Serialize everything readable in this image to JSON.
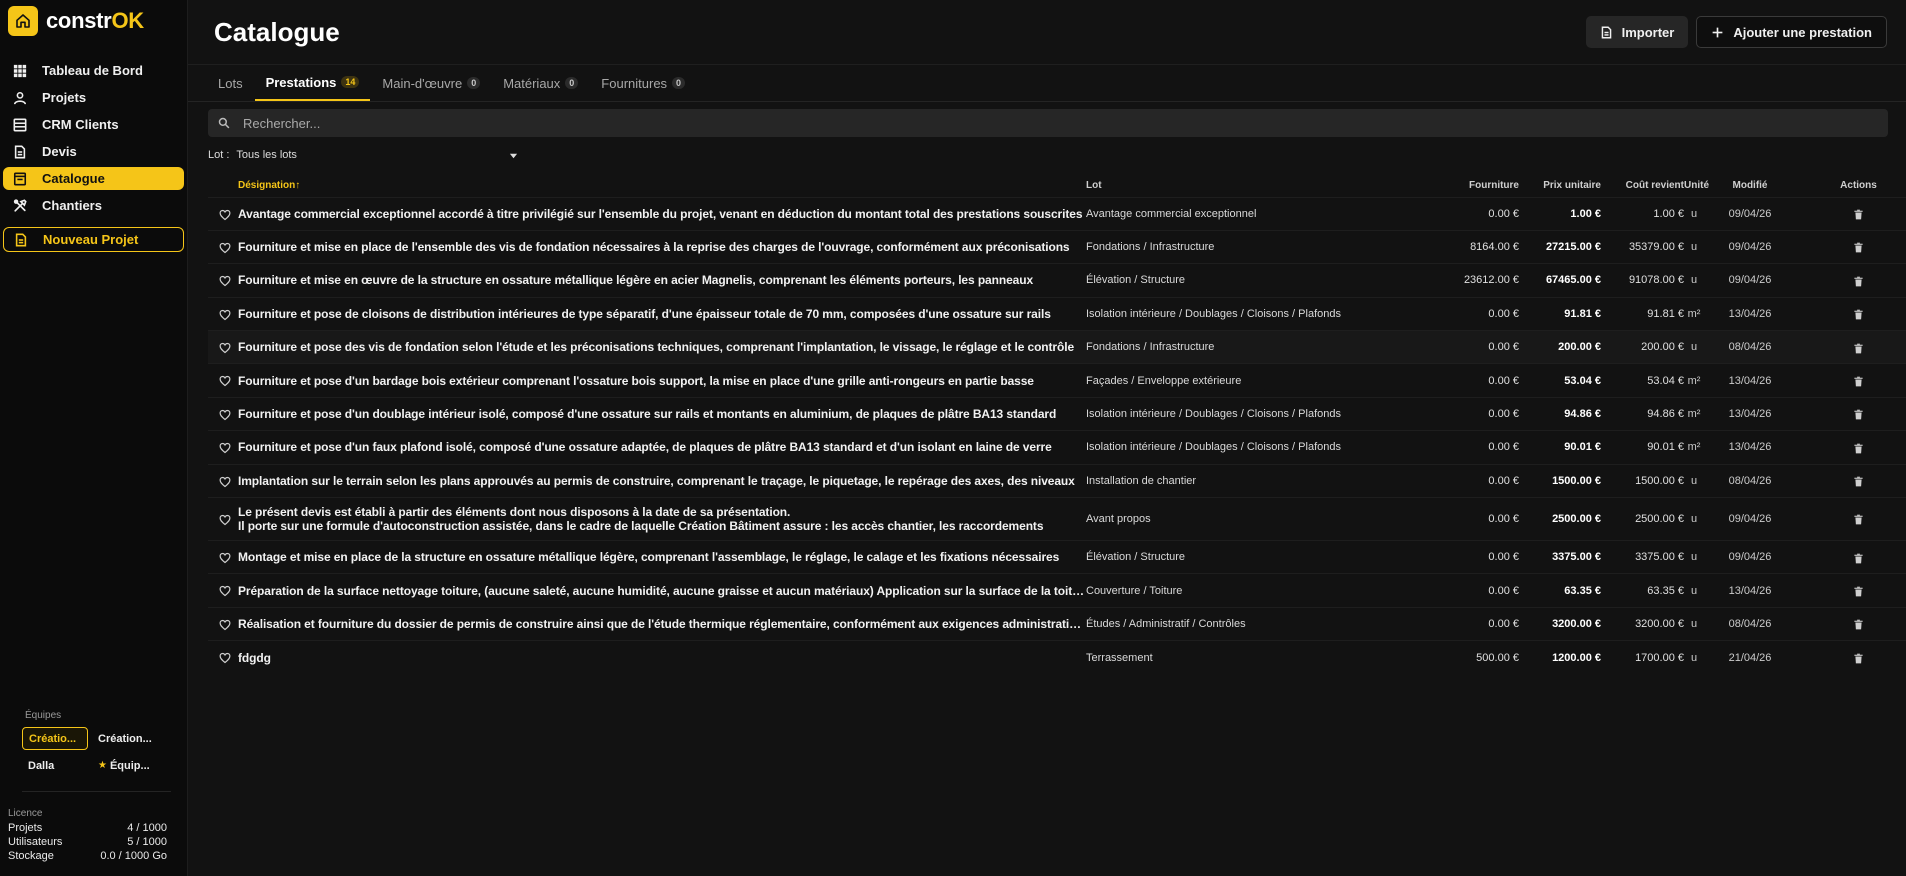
{
  "brand": {
    "name_main": "constr",
    "name_accent": "OK"
  },
  "sidebar": {
    "items": [
      {
        "label": "Tableau de Bord",
        "icon": "grid-icon"
      },
      {
        "label": "Projets",
        "icon": "user-icon"
      },
      {
        "label": "CRM Clients",
        "icon": "database-icon"
      },
      {
        "label": "Devis",
        "icon": "document-icon"
      },
      {
        "label": "Catalogue",
        "icon": "catalog-icon",
        "active": true
      },
      {
        "label": "Chantiers",
        "icon": "tools-icon"
      }
    ],
    "new_project": "Nouveau Projet"
  },
  "teams": {
    "title": "Équipes",
    "items": [
      "Créatio...",
      "Création...",
      "Dalla",
      "Équip..."
    ]
  },
  "license": {
    "title": "Licence",
    "rows": [
      {
        "label": "Projets",
        "value": "4 / 1000"
      },
      {
        "label": "Utilisateurs",
        "value": "5 / 1000"
      },
      {
        "label": "Stockage",
        "value": "0.0 / 1000 Go"
      }
    ]
  },
  "header": {
    "title": "Catalogue",
    "import_label": "Importer",
    "add_label": "Ajouter une prestation"
  },
  "tabs": [
    {
      "label": "Lots",
      "count": ""
    },
    {
      "label": "Prestations",
      "count": "14",
      "active": true
    },
    {
      "label": "Main-d'œuvre",
      "count": "0"
    },
    {
      "label": "Matériaux",
      "count": "0"
    },
    {
      "label": "Fournitures",
      "count": "0"
    }
  ],
  "search": {
    "placeholder": "Rechercher..."
  },
  "filter": {
    "label": "Lot :",
    "value": "Tous les lots"
  },
  "table": {
    "headers": {
      "designation": "Désignation",
      "sort_arrow": "↑",
      "lot": "Lot",
      "fourniture": "Fourniture",
      "prix": "Prix unitaire",
      "cout": "Coût revient",
      "unite": "Unité",
      "modifie": "Modifié",
      "actions": "Actions"
    },
    "rows": [
      {
        "des": "Avantage commercial exceptionnel accordé à titre privilégié sur l'ensemble du projet, venant en déduction du montant total des prestations souscrites",
        "lot": "Avantage commercial exceptionnel",
        "fourniture": "0.00 €",
        "prix": "1.00 €",
        "cout": "1.00 €",
        "unite": "u",
        "modifie": "09/04/26"
      },
      {
        "des": "Fourniture et mise en place de l'ensemble des vis de fondation nécessaires à la reprise des charges de l'ouvrage, conformément aux préconisations",
        "lot": "Fondations / Infrastructure",
        "fourniture": "8164.00 €",
        "prix": "27215.00 €",
        "cout": "35379.00 €",
        "unite": "u",
        "modifie": "09/04/26"
      },
      {
        "des": "Fourniture et mise en œuvre de la structure en ossature métallique légère en acier Magnelis, comprenant les éléments porteurs, les panneaux",
        "lot": "Élévation / Structure",
        "fourniture": "23612.00 €",
        "prix": "67465.00 €",
        "cout": "91078.00 €",
        "unite": "u",
        "modifie": "09/04/26"
      },
      {
        "des": "Fourniture et pose de cloisons de distribution intérieures de type séparatif, d'une épaisseur totale de 70 mm, composées d'une ossature sur rails",
        "lot": "Isolation intérieure / Doublages / Cloisons / Plafonds",
        "fourniture": "0.00 €",
        "prix": "91.81 €",
        "cout": "91.81 €",
        "unite": "m²",
        "modifie": "13/04/26"
      },
      {
        "des": "Fourniture et pose des vis de fondation selon l'étude et les préconisations techniques, comprenant l'implantation, le vissage, le réglage et le contrôle",
        "lot": "Fondations / Infrastructure",
        "fourniture": "0.00 €",
        "prix": "200.00 €",
        "cout": "200.00 €",
        "unite": "u",
        "modifie": "08/04/26",
        "hl": true
      },
      {
        "des": "Fourniture et pose d'un bardage bois extérieur comprenant l'ossature bois support, la mise en place d'une grille anti-rongeurs en partie basse",
        "lot": "Façades / Enveloppe extérieure",
        "fourniture": "0.00 €",
        "prix": "53.04 €",
        "cout": "53.04 €",
        "unite": "m²",
        "modifie": "13/04/26"
      },
      {
        "des": "Fourniture et pose d'un doublage intérieur isolé, composé d'une ossature sur rails et montants en aluminium, de plaques de plâtre BA13 standard",
        "lot": "Isolation intérieure / Doublages / Cloisons / Plafonds",
        "fourniture": "0.00 €",
        "prix": "94.86 €",
        "cout": "94.86 €",
        "unite": "m²",
        "modifie": "13/04/26"
      },
      {
        "des": "Fourniture et pose d'un faux plafond isolé, composé d'une ossature adaptée, de plaques de plâtre BA13 standard et d'un isolant en laine de verre",
        "lot": "Isolation intérieure / Doublages / Cloisons / Plafonds",
        "fourniture": "0.00 €",
        "prix": "90.01 €",
        "cout": "90.01 €",
        "unite": "m²",
        "modifie": "13/04/26"
      },
      {
        "des": "Implantation sur le terrain selon les plans approuvés au permis de construire, comprenant le traçage, le piquetage, le repérage des axes, des niveaux",
        "lot": "Installation de chantier",
        "fourniture": "0.00 €",
        "prix": "1500.00 €",
        "cout": "1500.00 €",
        "unite": "u",
        "modifie": "08/04/26"
      },
      {
        "des": "Le présent devis est établi à partir des éléments dont nous disposons à la date de sa présentation.",
        "des2": "Il porte sur une formule d'autoconstruction assistée, dans le cadre de laquelle Création Bâtiment assure : les accès chantier, les raccordements",
        "lot": "Avant propos",
        "fourniture": "0.00 €",
        "prix": "2500.00 €",
        "cout": "2500.00 €",
        "unite": "u",
        "modifie": "09/04/26",
        "tall": true
      },
      {
        "des": "Montage et mise en place de la structure en ossature métallique légère, comprenant l'assemblage, le réglage, le calage et les fixations nécessaires",
        "lot": "Élévation / Structure",
        "fourniture": "0.00 €",
        "prix": "3375.00 €",
        "cout": "3375.00 €",
        "unite": "u",
        "modifie": "09/04/26"
      },
      {
        "des": "Préparation de la surface nettoyage toiture, (aucune saleté, aucune humidité, aucune graisse et aucun matériaux) Application sur la surface de la toiture",
        "lot": "Couverture / Toiture",
        "fourniture": "0.00 €",
        "prix": "63.35 €",
        "cout": "63.35 €",
        "unite": "u",
        "modifie": "13/04/26"
      },
      {
        "des": "Réalisation et fourniture du dossier de permis de construire ainsi que de l'étude thermique réglementaire, conformément aux exigences administratives",
        "lot": "Études / Administratif / Contrôles",
        "fourniture": "0.00 €",
        "prix": "3200.00 €",
        "cout": "3200.00 €",
        "unite": "u",
        "modifie": "08/04/26"
      },
      {
        "des": "fdgdg",
        "lot": "Terrassement",
        "fourniture": "500.00 €",
        "prix": "1200.00 €",
        "cout": "1700.00 €",
        "unite": "u",
        "modifie": "21/04/26"
      }
    ]
  },
  "colors": {
    "accent": "#f5c518",
    "background": "#121212",
    "sidebar": "#0b0b0b"
  }
}
